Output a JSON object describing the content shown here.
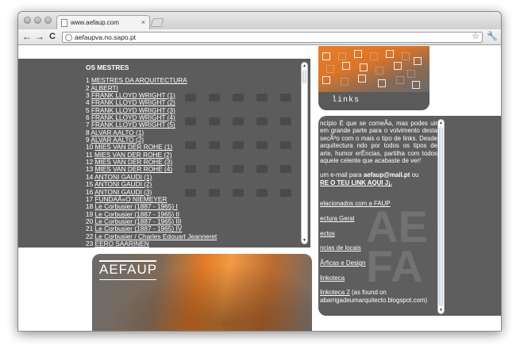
{
  "browser": {
    "tab_title": "www.aefaup.com",
    "tab_close": "×",
    "url": "aefaupva.no.sapo.pt",
    "back": "←",
    "forward": "→",
    "reload": "C",
    "star": "☆",
    "wrench": "🔧"
  },
  "mestres": {
    "title": "OS MESTRES",
    "items": [
      {
        "num": "1",
        "label": "MESTRES DA ARQUITECTURA"
      },
      {
        "num": "2",
        "label": "ALBERTI"
      },
      {
        "num": "3",
        "label": "FRANK LLOYD WRIGHT (1)"
      },
      {
        "num": "4",
        "label": "FRANK LLOYD WRIGHT (2)"
      },
      {
        "num": "5",
        "label": "FRANK LLOYD WRIGHT (3)"
      },
      {
        "num": "6",
        "label": "FRANK LLOYD WRIGHT (4)"
      },
      {
        "num": "7",
        "label": "FRANK LLOYD WRIGHT (5)"
      },
      {
        "num": "8",
        "label": "ALVAR AALTO (1)"
      },
      {
        "num": "9",
        "label": "ALVAR AALTO (2)"
      },
      {
        "num": "10",
        "label": "MIES VAN DER ROHE (1)"
      },
      {
        "num": "11",
        "label": "MIES VAN DER ROHE (2)"
      },
      {
        "num": "12",
        "label": "MIES VAN DER ROHE (3)"
      },
      {
        "num": "13",
        "label": "MIES VAN DER ROHE (4)"
      },
      {
        "num": "14",
        "label": "ANTONI GAUDI (1)"
      },
      {
        "num": "15",
        "label": "ANTONI GAUDI (2)"
      },
      {
        "num": "16",
        "label": "ANTONI GAUDI (3)"
      },
      {
        "num": "17",
        "label": "FUNDAÃ«O NIEMEYER"
      },
      {
        "num": "18",
        "label": "Le Corbusier (1887 - 1965) I"
      },
      {
        "num": "19",
        "label": "Le Corbusier (1887 - 1965) II"
      },
      {
        "num": "20",
        "label": "Le Corbusier (1887 - 1965) III"
      },
      {
        "num": "21",
        "label": "Le Corbusier (1887 - 1965) IV"
      },
      {
        "num": "22",
        "label": "Le Corbusier / Charles Edouart Jeanneret"
      },
      {
        "num": "23",
        "label": "EERO SAARINEN"
      }
    ]
  },
  "banner": {
    "logo": "AEFAUP"
  },
  "links_box": {
    "label": "links"
  },
  "right": {
    "para1": "ncípio È que se comeÃa, mas podes uir em grande parte para o volvimento desta secÃºo com o mais o tipo de links. Desde arquitectura ndo por todos os tipos de arte, humor erÊncias, partilha com todos aquele celente que acabaste de ver!",
    "para2_prefix": "um e-mail para ",
    "email": "aefaup@mail.pt",
    "para2_mid": " ou",
    "submit_link": "RE O TEU LINK AQUI J¡.",
    "links": [
      "elacionados com a FAUP",
      "ectura Geral",
      "ectos",
      "ncias de locais",
      "Ãrficas e Design",
      "linkoteca"
    ],
    "link_last": "linkoteca 2",
    "link_last_suffix": " (as found on",
    "link_last_line2": "abarrigadeumarquitecto.blogspot.com)",
    "bg_text": "AE\nFA"
  },
  "colors": {
    "panel_gray": "#5c5c5c",
    "accent_orange": "#e07a27"
  }
}
